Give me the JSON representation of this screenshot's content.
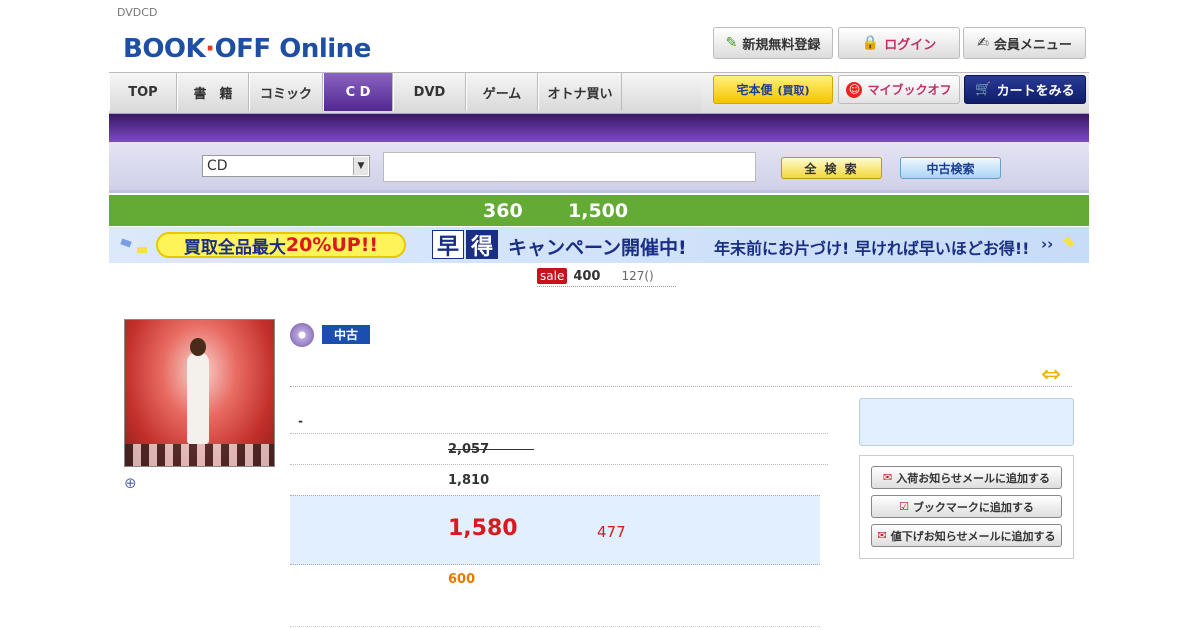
{
  "tagline": "DVDCD",
  "header": {
    "logo": {
      "part1": "BOOK",
      "dot": "·",
      "part2": "OFF",
      "part3": "Online"
    },
    "buttons": [
      {
        "label": "新規無料登録",
        "icon": "pencil-icon"
      },
      {
        "label": "ログイン",
        "icon": "lock-icon"
      },
      {
        "label": "会員メニュー",
        "icon": "note-icon"
      }
    ]
  },
  "nav": {
    "tabs": [
      "TOP",
      "書　籍",
      "コミック",
      "C D",
      "DVD",
      "ゲーム",
      "オトナ買い"
    ],
    "active_index": 3,
    "services": [
      {
        "label": "宅本便",
        "sub": "(買取)"
      },
      {
        "label": "マイブックオフ",
        "icon": "smiley-icon"
      },
      {
        "label": "カートをみる",
        "icon": "cart-icon"
      }
    ]
  },
  "search": {
    "category": "CD",
    "query": "",
    "all_button": "全 検 索",
    "used_button": "中古検索"
  },
  "promo": {
    "value1": "360",
    "value2": "1,500"
  },
  "banner": {
    "pill_prefix": "買取全品最大",
    "pill_highlight": "20%UP!!",
    "haya": "早",
    "toku": "得",
    "campaign": "キャンペーン開催中!",
    "message": "年末前にお片づけ! 早ければ早いほどお得!!",
    "more": "››"
  },
  "sale": {
    "badge": "sale",
    "price": "400",
    "count": "127()"
  },
  "product": {
    "condition": "中古",
    "row1": "-",
    "list_price": "2,057",
    "regular_price": "1,810",
    "sale_price": "1,580",
    "discount": "477",
    "points": "600"
  },
  "actions": [
    {
      "label": "入荷お知らせメールに追加する",
      "icon": "mail-icon"
    },
    {
      "label": "ブックマークに追加する",
      "icon": "check-icon"
    },
    {
      "label": "値下げお知らせメールに追加する",
      "icon": "mail-icon"
    }
  ],
  "colors": {
    "accent": "#52278f",
    "green": "#63ab34",
    "price_red": "#d8191e",
    "points_orange": "#e67a00"
  }
}
